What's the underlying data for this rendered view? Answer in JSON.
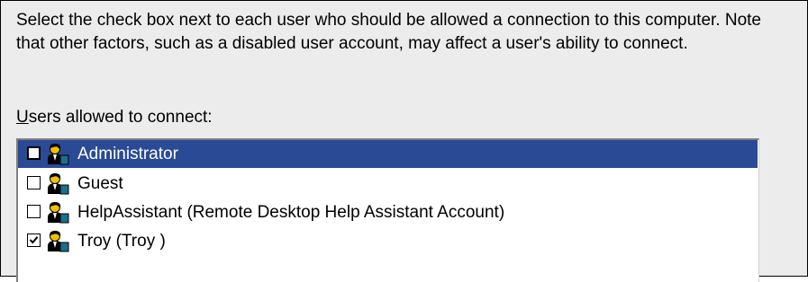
{
  "description": "Select the check box next to each user who should be allowed a connection to this computer.  Note that other factors, such as a disabled user account, may affect a user's ability to connect.",
  "users_label": {
    "mnemonic": "U",
    "rest": "sers allowed to connect:"
  },
  "users": [
    {
      "name": "Administrator",
      "checked": false,
      "selected": true,
      "icon": "user-icon"
    },
    {
      "name": "Guest",
      "checked": false,
      "selected": false,
      "icon": "user-icon"
    },
    {
      "name": "HelpAssistant (Remote Desktop Help Assistant Account)",
      "checked": false,
      "selected": false,
      "icon": "user-icon"
    },
    {
      "name": "Troy (Troy )",
      "checked": true,
      "selected": false,
      "icon": "user-icon"
    }
  ],
  "colors": {
    "selection": "#2a4a96",
    "dialog_background": "#ececec"
  }
}
